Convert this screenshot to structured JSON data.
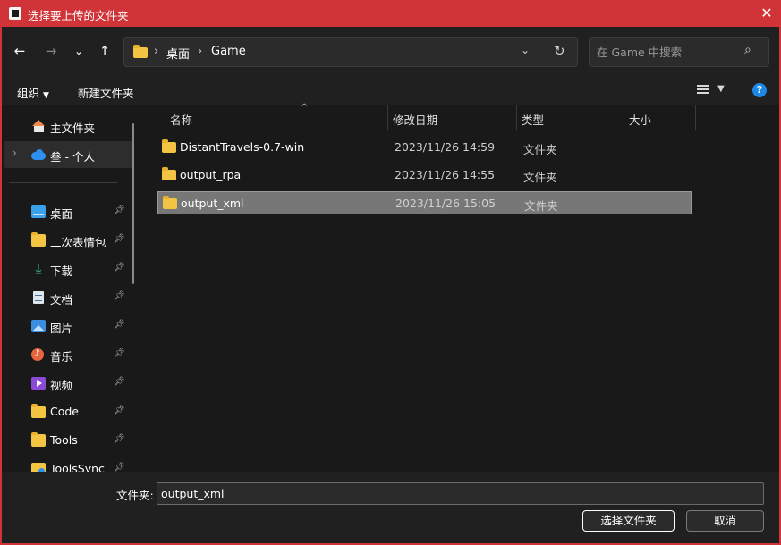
{
  "window": {
    "title": "选择要上传的文件夹",
    "close_label": "✕"
  },
  "address": {
    "crumbs": [
      "桌面",
      "Game"
    ],
    "separator": "›"
  },
  "search": {
    "placeholder": "在 Game 中搜索"
  },
  "toolbar": {
    "organize_label": "组织",
    "new_folder_label": "新建文件夹"
  },
  "nav": {
    "items": [
      {
        "label": "主文件夹",
        "icon": "home-icon"
      },
      {
        "label": "叁 - 个人",
        "icon": "onedrive-cloud-icon"
      },
      {
        "label": "桌面",
        "icon": "desktop-icon"
      },
      {
        "label": "二次表情包",
        "icon": "folder-icon"
      },
      {
        "label": "下载",
        "icon": "download-icon"
      },
      {
        "label": "文档",
        "icon": "document-icon"
      },
      {
        "label": "图片",
        "icon": "pictures-icon"
      },
      {
        "label": "音乐",
        "icon": "music-icon"
      },
      {
        "label": "视频",
        "icon": "video-icon"
      },
      {
        "label": "Code",
        "icon": "folder-icon"
      },
      {
        "label": "Tools",
        "icon": "folder-icon"
      },
      {
        "label": "ToolsSync",
        "icon": "sync-folder-icon"
      }
    ]
  },
  "columns": {
    "name": "名称",
    "modified": "修改日期",
    "type": "类型",
    "size": "大小"
  },
  "files": [
    {
      "name": "DistantTravels-0.7-win",
      "modified": "2023/11/26 14:59",
      "type": "文件夹",
      "selected": false
    },
    {
      "name": "output_rpa",
      "modified": "2023/11/26 14:55",
      "type": "文件夹",
      "selected": false
    },
    {
      "name": "output_xml",
      "modified": "2023/11/26 15:05",
      "type": "文件夹",
      "selected": true
    }
  ],
  "footer": {
    "folder_label": "文件夹:",
    "folder_value": "output_xml",
    "select_button": "选择文件夹",
    "cancel_button": "取消"
  },
  "colors": {
    "accent": "#d13438",
    "background": "#191919",
    "selection": "#777777",
    "folder": "#f4c542"
  }
}
